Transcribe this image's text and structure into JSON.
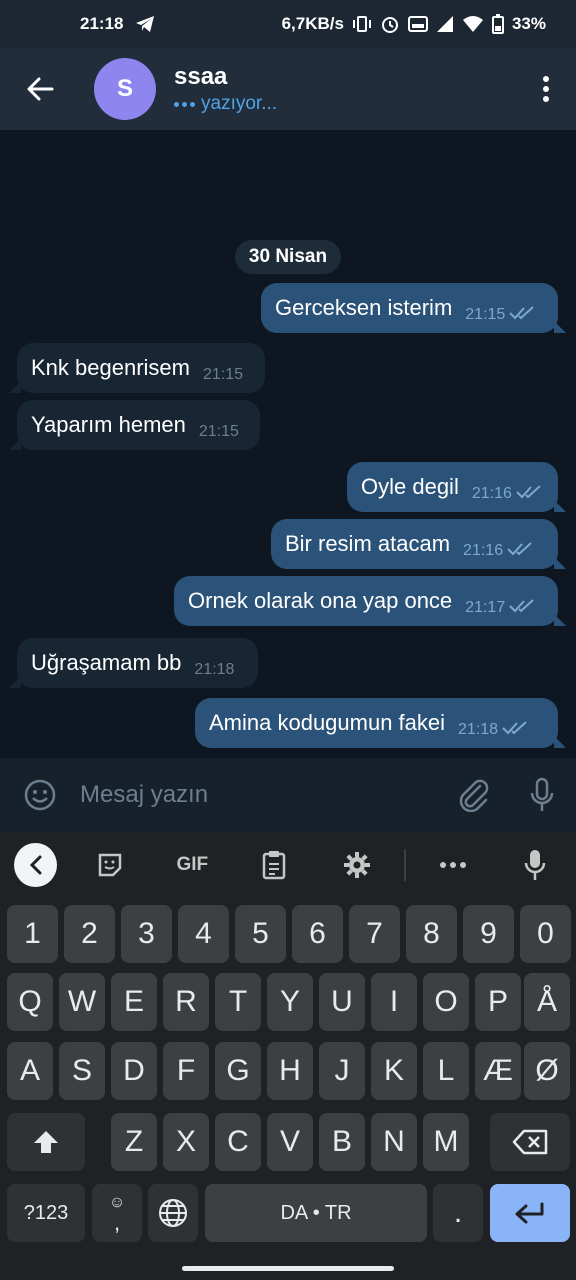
{
  "status_bar": {
    "time": "21:18",
    "net_speed": "6,7KB/s",
    "battery": "33%"
  },
  "header": {
    "avatar_letter": "S",
    "chat_name": "ssaa",
    "status": "yazıyor..."
  },
  "chat": {
    "date": "30 Nisan",
    "messages": [
      {
        "dir": "out",
        "text": "Gerceksen isterim",
        "time": "21:15"
      },
      {
        "dir": "in",
        "text": "Knk begenrisem",
        "time": "21:15"
      },
      {
        "dir": "in",
        "text": "Yaparım hemen",
        "time": "21:15"
      },
      {
        "dir": "out",
        "text": "Oyle degil",
        "time": "21:16"
      },
      {
        "dir": "out",
        "text": "Bir resim atacam",
        "time": "21:16"
      },
      {
        "dir": "out",
        "text": "Ornek olarak ona yap once",
        "time": "21:17"
      },
      {
        "dir": "in",
        "text": "Uğraşamam bb",
        "time": "21:18"
      },
      {
        "dir": "out",
        "text": "Amina kodugumun fakei",
        "time": "21:18"
      }
    ]
  },
  "input": {
    "placeholder": "Mesaj yazın"
  },
  "keyboard": {
    "toolbar": {
      "gif": "GIF"
    },
    "row_numbers": [
      "1",
      "2",
      "3",
      "4",
      "5",
      "6",
      "7",
      "8",
      "9",
      "0"
    ],
    "row_q": [
      "Q",
      "W",
      "E",
      "R",
      "T",
      "Y",
      "U",
      "I",
      "O",
      "P",
      "Å"
    ],
    "row_a": [
      "A",
      "S",
      "D",
      "F",
      "G",
      "H",
      "J",
      "K",
      "L",
      "Æ",
      "Ø"
    ],
    "row_z": [
      "Z",
      "X",
      "C",
      "V",
      "B",
      "N",
      "M"
    ],
    "symbols_label": "?123",
    "emoji_comma": ",",
    "space_label": "DA • TR",
    "period": "."
  },
  "colors": {
    "outgoing_bubble": "#2b5278",
    "incoming_bubble": "#182533",
    "accent": "#4fa3e6",
    "enter_key": "#8ab4f8"
  }
}
